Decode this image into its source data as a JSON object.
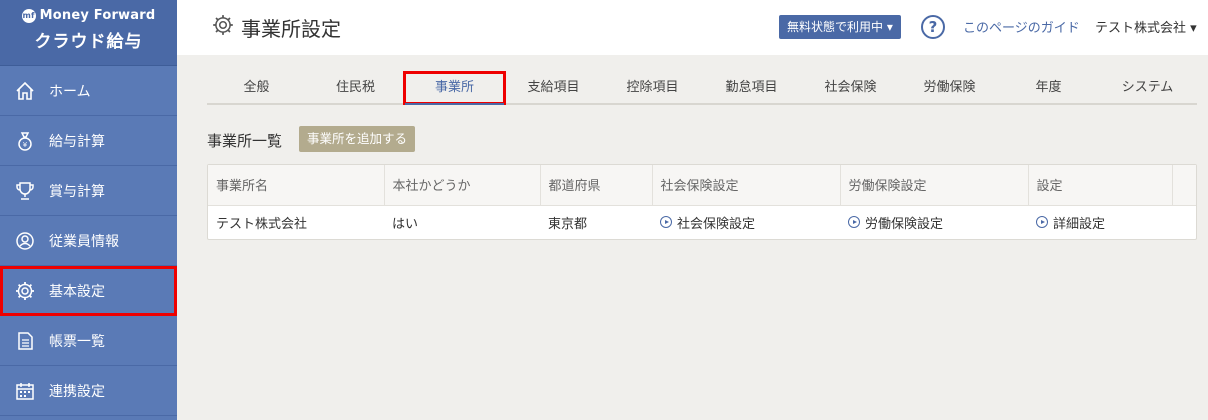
{
  "app": {
    "brand": "Money Forward",
    "product": "クラウド給与"
  },
  "sidebar": {
    "items": [
      {
        "label": "ホーム",
        "icon": "home-icon"
      },
      {
        "label": "給与計算",
        "icon": "money-bag-icon"
      },
      {
        "label": "賞与計算",
        "icon": "trophy-icon"
      },
      {
        "label": "従業員情報",
        "icon": "user-icon"
      },
      {
        "label": "基本設定",
        "icon": "gear-icon"
      },
      {
        "label": "帳票一覧",
        "icon": "document-icon"
      },
      {
        "label": "連携設定",
        "icon": "calendar-icon"
      }
    ]
  },
  "header": {
    "title": "事業所設定",
    "plan_button": "無料状態で利用中",
    "guide_link": "このページのガイド",
    "company": "テスト株式会社"
  },
  "tabs": [
    "全般",
    "住民税",
    "事業所",
    "支給項目",
    "控除項目",
    "勤怠項目",
    "社会保険",
    "労働保険",
    "年度",
    "システム"
  ],
  "section": {
    "title": "事業所一覧",
    "add_button": "事業所を追加する"
  },
  "table": {
    "headers": [
      "事業所名",
      "本社かどうか",
      "都道府県",
      "社会保険設定",
      "労働保険設定",
      "設定"
    ],
    "rows": [
      {
        "name": "テスト株式会社",
        "is_hq": "はい",
        "prefecture": "東京都",
        "social_insurance": "社会保険設定",
        "labor_insurance": "労働保険設定",
        "detail": "詳細設定"
      }
    ]
  },
  "colors": {
    "sidebar": "#5a7ab6",
    "accent": "#4a69a6",
    "add_button": "#b3ab8e",
    "highlight": "#ee0000"
  }
}
